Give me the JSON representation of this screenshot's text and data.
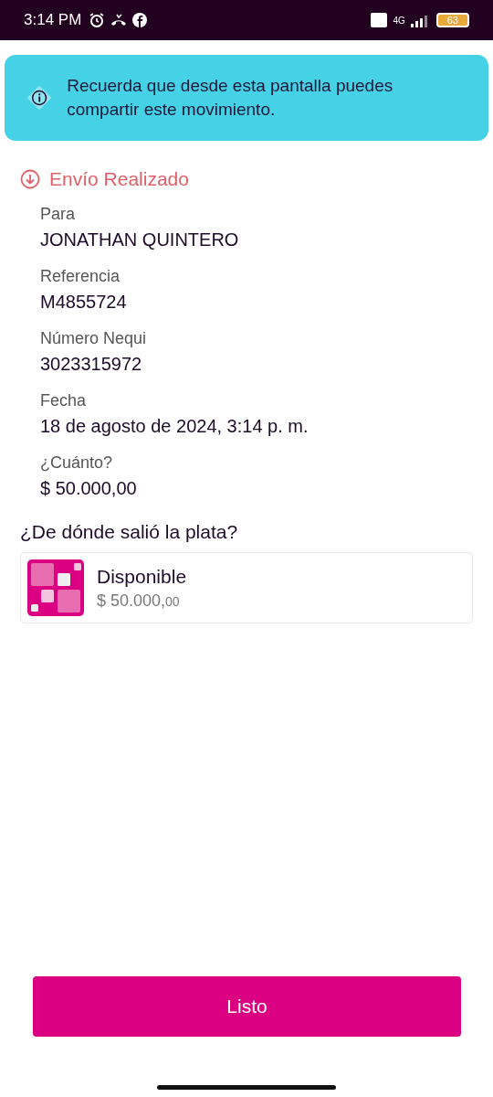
{
  "status_bar": {
    "time": "3:14 PM",
    "network": "4G",
    "battery": "63"
  },
  "toast": {
    "message": "Recuerda que desde esta pantalla puedes compartir este movimiento."
  },
  "status": {
    "label": "Envío Realizado"
  },
  "fields": [
    {
      "label": "Para",
      "value": "JONATHAN QUINTERO"
    },
    {
      "label": "Referencia",
      "value": "M4855724"
    },
    {
      "label": "Número Nequi",
      "value": "3023315972"
    },
    {
      "label": "Fecha",
      "value": "18 de agosto de 2024, 3:14 p. m."
    },
    {
      "label": "¿Cuánto?",
      "value": "$ 50.000,00"
    }
  ],
  "source": {
    "heading": "¿De dónde salió la plata?",
    "name": "Disponible",
    "amount": "$ 50.000,",
    "cents": "00"
  },
  "button": "Listo"
}
